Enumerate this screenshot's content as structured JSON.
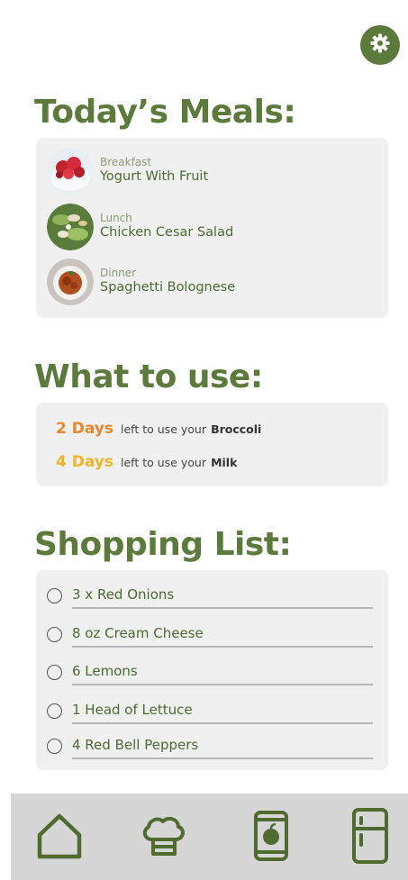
{
  "colors": {
    "accent": "#5b7a3b",
    "card_bg": "#f0f0f0",
    "nav_bg": "#d6d6d6",
    "urgent": "#e8872a",
    "warning": "#f0b429"
  },
  "header": {
    "settings_icon": "gear-icon"
  },
  "meals": {
    "title": "Today’s Meals:",
    "items": [
      {
        "type": "Breakfast",
        "name": "Yogurt With Fruit"
      },
      {
        "type": "Lunch",
        "name": "Chicken Cesar Salad"
      },
      {
        "type": "Dinner",
        "name": "Spaghetti Bolognese"
      }
    ]
  },
  "use": {
    "title": "What to use:",
    "items": [
      {
        "days": "2 Days",
        "text": "left to use your",
        "item": "Broccoli",
        "color": "#e8872a"
      },
      {
        "days": "4 Days",
        "text": "left to use your",
        "item": "Milk",
        "color": "#f0b429"
      }
    ]
  },
  "shopping": {
    "title": "Shopping List:",
    "items": [
      {
        "label": "3 x Red Onions",
        "checked": false
      },
      {
        "label": "8 oz Cream Cheese",
        "checked": false
      },
      {
        "label": "6 Lemons",
        "checked": false
      },
      {
        "label": "1 Head of Lettuce",
        "checked": false
      },
      {
        "label": "4 Red Bell Peppers",
        "checked": false
      }
    ]
  },
  "nav": {
    "items": [
      {
        "icon": "home-icon"
      },
      {
        "icon": "chef-hat-icon"
      },
      {
        "icon": "pantry-jar-icon"
      },
      {
        "icon": "fridge-icon"
      }
    ]
  }
}
